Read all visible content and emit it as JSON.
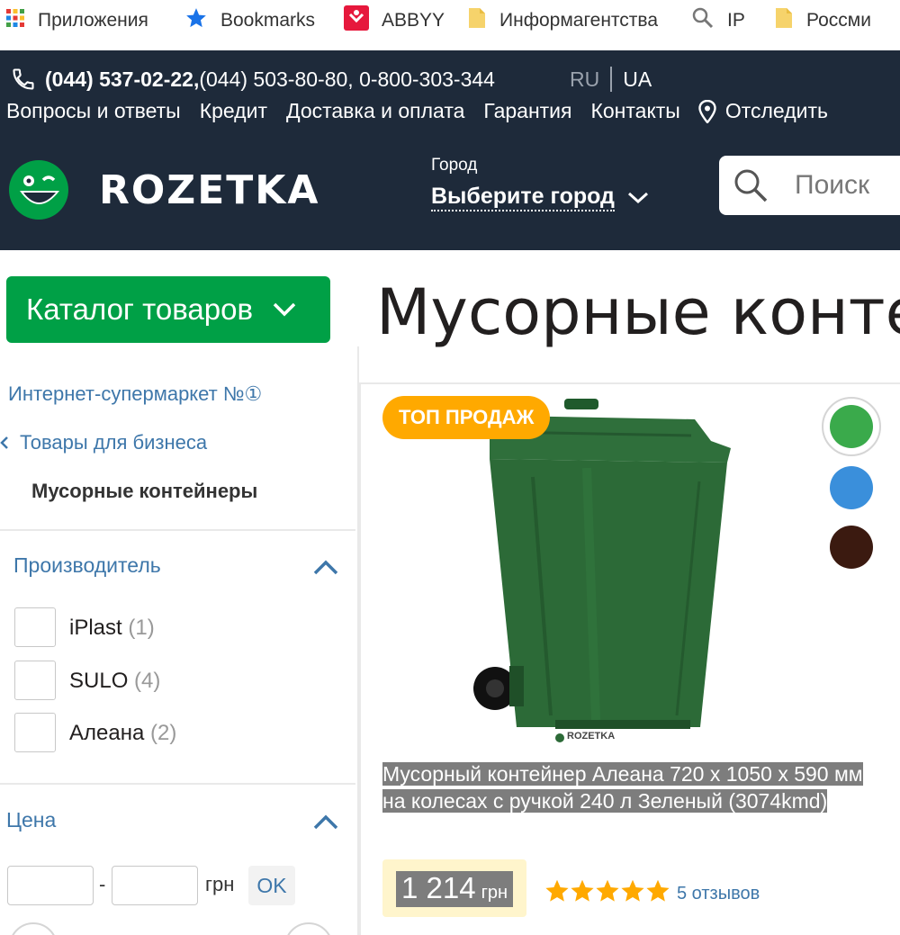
{
  "bookmarks": [
    {
      "label": "Приложения",
      "icon": "apps-grid-icon"
    },
    {
      "label": "Bookmarks",
      "icon": "star-icon"
    },
    {
      "label": "ABBYY",
      "icon": "abbyy-icon"
    },
    {
      "label": "Информагентства",
      "icon": "folder-icon"
    },
    {
      "label": "IP",
      "icon": "search-icon"
    },
    {
      "label": "Россми",
      "icon": "folder-icon"
    }
  ],
  "header": {
    "phone_main": "(044) 537-02-22,",
    "phone_others": " (044) 503-80-80, 0-800-303-344",
    "lang_ru": "RU",
    "lang_ua": "UA",
    "nav": [
      "Вопросы и ответы",
      "Кредит",
      "Доставка и оплата",
      "Гарантия",
      "Контакты",
      "Отследить"
    ],
    "logo_text": "ROZETKA",
    "city_label": "Город",
    "city_value": "Выберите город",
    "search_placeholder": "Поиск"
  },
  "sidebar": {
    "catalog_button": "Каталог товаров",
    "breadcrumb_top": "Интернет-супермаркет №①",
    "breadcrumb_parent": "Товары для бизнеса",
    "breadcrumb_current": "Мусорные контейнеры",
    "manufacturer_title": "Производитель",
    "manufacturers": [
      {
        "name": "iPlast",
        "count": "(1)"
      },
      {
        "name": "SULO",
        "count": "(4)"
      },
      {
        "name": "Алеана",
        "count": "(2)"
      }
    ],
    "price_title": "Цена",
    "price_from": "",
    "price_dash": "-",
    "price_to": "",
    "price_currency": "грн",
    "price_ok": "OK"
  },
  "main": {
    "title": "Мусорные конте",
    "badge": "ТОП ПРОДАЖ",
    "product_title": "Мусорный контейнер Алеана 720 х 1050 х 590 мм на колесах с ручкой 240 л Зеленый (3074kmd)",
    "price_value": "1 214",
    "price_currency": "грн",
    "reviews": "5 отзывов",
    "rating": 5,
    "image_watermark": "ROZETKA",
    "swatches": [
      "#3aaa4b",
      "#3a8fdb",
      "#3b1a10"
    ]
  },
  "colors": {
    "header_bg": "#1e2a3a",
    "accent_green": "#00a046",
    "badge_orange": "#ffa900",
    "link_blue": "#3e77aa",
    "star_gold": "#ffa900"
  }
}
